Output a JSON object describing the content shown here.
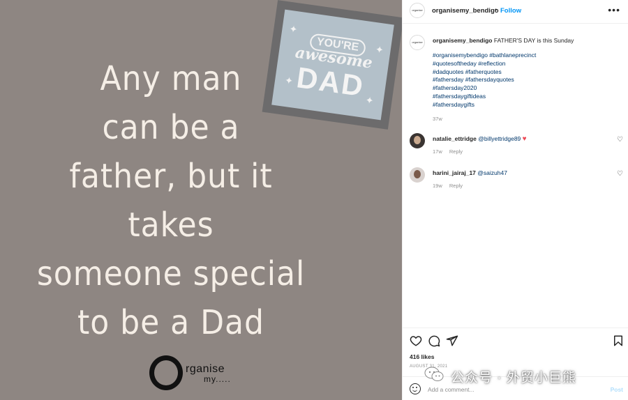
{
  "image": {
    "quote_lines": [
      "Any man",
      "can be a",
      "father, but it",
      "takes",
      "someone special",
      "to be a Dad"
    ],
    "card": {
      "top": "YOU'RE",
      "middle": "awesome",
      "bottom": "DAD"
    },
    "logo": {
      "word": "rganise",
      "sub": "my....."
    },
    "background_color": "#8e8682"
  },
  "header": {
    "username": "organisemy_bendigo",
    "separator": "•",
    "follow_label": "Follow",
    "more_icon": "more-icon",
    "avatar_text": "organise my"
  },
  "caption": {
    "username": "organisemy_bendigo",
    "text": "FATHER'S DAY is this Sunday",
    "hashtags": [
      "#organisemybendigo #bathlaneprecinct",
      "#quotesoftheday #reflection",
      "#dadquotes #fatherquotes",
      "#fathersday #fathersdayquotes",
      "#fathersday2020",
      "#fathersdaygiftideas",
      "#fathersdaygifts"
    ],
    "time": "37w"
  },
  "comments": [
    {
      "username": "natalie_ettridge",
      "text": "@billyettridge89",
      "emoji": "♥",
      "time": "17w",
      "reply": "Reply"
    },
    {
      "username": "harini_jairaj_17",
      "text": "@saizuh47",
      "emoji": "",
      "time": "19w",
      "reply": "Reply"
    }
  ],
  "actions": {
    "likes": "416 likes",
    "date": "AUGUST 31, 2021"
  },
  "comment_box": {
    "placeholder": "Add a comment...",
    "post_label": "Post"
  },
  "watermark": {
    "text": "公众号 · 外贸小巨熊"
  },
  "colors": {
    "link_blue": "#0095f6",
    "hashtag_blue": "#00376b",
    "heart_red": "#ed4956",
    "muted_gray": "#8e8e8e"
  }
}
